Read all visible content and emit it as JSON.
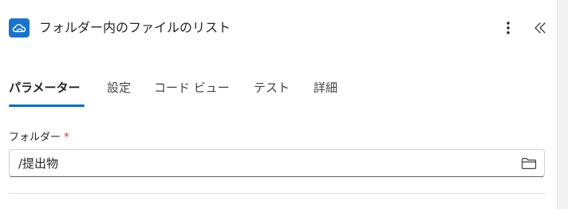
{
  "header": {
    "title": "フォルダー内のファイルのリスト",
    "app_icon": "onedrive-cloud-icon",
    "more_icon": "more-vertical-icon",
    "collapse_icon": "double-chevron-left-icon",
    "accent_color": "#1a73c9"
  },
  "tabs": [
    {
      "label": "パラメーター",
      "active": true
    },
    {
      "label": "設定",
      "active": false
    },
    {
      "label": "コード ビュー",
      "active": false
    },
    {
      "label": "テスト",
      "active": false
    },
    {
      "label": "詳細",
      "active": false
    }
  ],
  "tab_indicator_color": "#0f6cbd",
  "field": {
    "label": "フォルダー",
    "required_mark": "*",
    "value": "/提出物",
    "browse_icon": "folder-icon"
  }
}
